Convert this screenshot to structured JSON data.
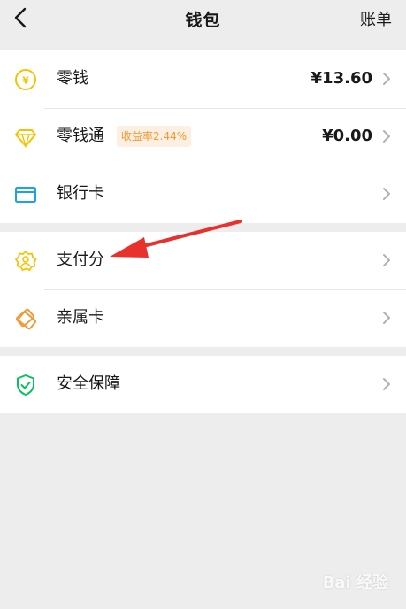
{
  "nav": {
    "title": "钱包",
    "right_label": "账单"
  },
  "groups": [
    {
      "items": [
        {
          "label": "零钱",
          "value": "¥13.60",
          "icon": "yen-coin-icon"
        },
        {
          "label": "零钱通",
          "badge": "收益率2.44%",
          "value": "¥0.00",
          "icon": "diamond-icon"
        },
        {
          "label": "银行卡",
          "icon": "bank-card-icon"
        }
      ]
    },
    {
      "items": [
        {
          "label": "支付分",
          "icon": "pay-score-badge-icon"
        },
        {
          "label": "亲属卡",
          "icon": "family-card-icon"
        }
      ]
    },
    {
      "items": [
        {
          "label": "安全保障",
          "icon": "shield-check-icon"
        }
      ]
    }
  ],
  "colors": {
    "yellow": "#f5c400",
    "orange": "#f29a38",
    "blue": "#1aa3e8",
    "green": "#07c160",
    "arrow_red": "#e8302c"
  },
  "watermark": "Bai 经验"
}
